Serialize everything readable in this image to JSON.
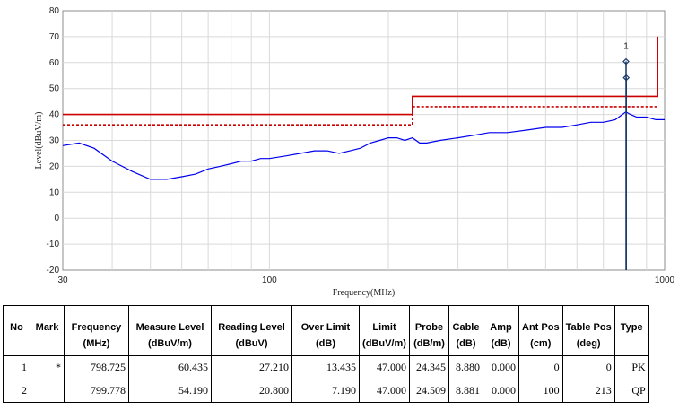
{
  "chart_data": {
    "type": "line",
    "xlabel": "Frequency(MHz)",
    "ylabel": "Level(dBuV/m)",
    "xscale": "log",
    "xlim": [
      30,
      1000
    ],
    "ylim": [
      -20,
      80
    ],
    "xticks": [
      "30",
      "100",
      "1000"
    ],
    "yticks": [
      "-20",
      "-10",
      "0",
      "10",
      "20",
      "30",
      "40",
      "50",
      "60",
      "70",
      "80"
    ],
    "grid": true,
    "series": [
      {
        "color": "#0000ee",
        "x": [
          30,
          33,
          36,
          40,
          45,
          50,
          55,
          60,
          65,
          70,
          75,
          80,
          85,
          90,
          95,
          100,
          110,
          120,
          130,
          140,
          150,
          160,
          170,
          180,
          190,
          200,
          210,
          220,
          230,
          240,
          250,
          270,
          300,
          330,
          360,
          400,
          450,
          500,
          550,
          600,
          650,
          700,
          750,
          798,
          820,
          850,
          900,
          950,
          1000
        ],
        "y": [
          28,
          29,
          27,
          22,
          18,
          15,
          15,
          16,
          17,
          19,
          20,
          21,
          22,
          22,
          23,
          23,
          24,
          25,
          26,
          26,
          25,
          26,
          27,
          29,
          30,
          31,
          31,
          30,
          31,
          29,
          29,
          30,
          31,
          32,
          33,
          33,
          34,
          35,
          35,
          36,
          37,
          37,
          38,
          41,
          40,
          39,
          39,
          38,
          38
        ]
      },
      {
        "color": "#cc0000",
        "x": [
          30,
          230,
          230,
          960,
          960
        ],
        "y": [
          40,
          40,
          47,
          47,
          70
        ]
      },
      {
        "color": "#cc0000",
        "x": [
          30,
          230,
          230,
          960
        ],
        "y": [
          36,
          36,
          43,
          43
        ]
      }
    ],
    "markers": [
      {
        "label": "1",
        "x": 798.725,
        "y": 60.435
      },
      {
        "label": "",
        "x": 799.778,
        "y": 54.19
      }
    ]
  },
  "table": {
    "header_row1": [
      "No",
      "Mark",
      "Frequency",
      "Measure Level",
      "Reading Level",
      "Over Limit",
      "Limit",
      "Probe",
      "Cable",
      "Amp",
      "Ant Pos",
      "Table Pos",
      "Type"
    ],
    "header_row2": [
      "",
      "",
      "(MHz)",
      "(dBuV/m)",
      "(dBuV)",
      "(dB)",
      "(dBuV/m)",
      "(dB/m)",
      "(dB)",
      "(dB)",
      "(cm)",
      "(deg)",
      ""
    ],
    "rows": [
      [
        "1",
        "*",
        "798.725",
        "60.435",
        "27.210",
        "13.435",
        "47.000",
        "24.345",
        "8.880",
        "0.000",
        "0",
        "0",
        "PK"
      ],
      [
        "2",
        "",
        "799.778",
        "54.190",
        "20.800",
        "7.190",
        "47.000",
        "24.509",
        "8.881",
        "0.000",
        "100",
        "213",
        "QP"
      ]
    ]
  }
}
